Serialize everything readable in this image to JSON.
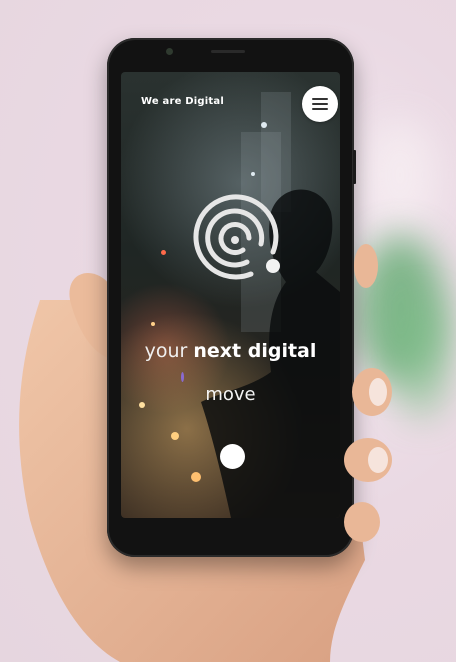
{
  "site": {
    "brand": "We are Digital",
    "tagline_light": "your",
    "tagline_bold": "next digital",
    "subline": "move"
  },
  "icons": {
    "menu": "hamburger-menu-icon",
    "logo": "concentric-spiral-logo",
    "scroll": "scroll-down-dot"
  },
  "colors": {
    "accent": "#ffffff",
    "text": "#ffffff",
    "background_page": "#ead9e3"
  }
}
